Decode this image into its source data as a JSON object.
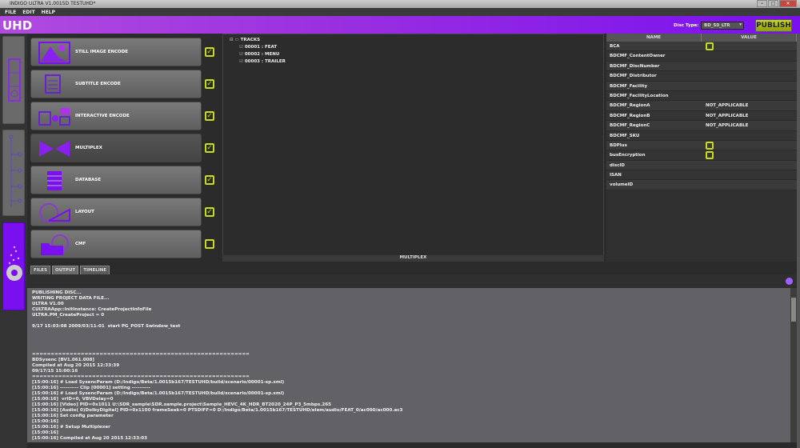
{
  "window": {
    "title": "INDIGO ULTRA V1.0015D TESTUHD*",
    "min": "–",
    "max": "□",
    "close": "✕"
  },
  "menu": [
    "FILE",
    "EDIT",
    "HELP"
  ],
  "header": {
    "title": "UHD",
    "disc_type_label": "Disc Type:",
    "disc_type_value": "BD_50_LTR",
    "publish_label": "PUBLISH",
    "accent": "#9b30e0"
  },
  "steps": [
    {
      "label": "STILL IMAGE ENCODE",
      "checked": true
    },
    {
      "label": "SUBTITLE ENCODE",
      "checked": true
    },
    {
      "label": "INTERACTIVE ENCODE",
      "checked": true
    },
    {
      "label": "MULTIPLEX",
      "checked": true
    },
    {
      "label": "DATABASE",
      "checked": true
    },
    {
      "label": "LAYOUT",
      "checked": true
    },
    {
      "label": "CMF",
      "checked": false
    }
  ],
  "tree": {
    "root": "TRACKS",
    "items": [
      "00001 : FEAT",
      "00002 : MENU",
      "00003 : TRAILER"
    ],
    "footer": "MULTIPLEX"
  },
  "properties": {
    "headers": [
      "NAME",
      "VALUE"
    ],
    "rows": [
      {
        "name": "BCA",
        "value": "",
        "checkbox": true
      },
      {
        "name": "BDCMF_ContentOwner",
        "value": ""
      },
      {
        "name": "BDCMF_DiscNumber",
        "value": ""
      },
      {
        "name": "BDCMF_Distributor",
        "value": ""
      },
      {
        "name": "BDCMF_Facility",
        "value": ""
      },
      {
        "name": "BDCMF_FacilityLocation",
        "value": ""
      },
      {
        "name": "BDCMF_RegionA",
        "value": "NOT_APPLICABLE"
      },
      {
        "name": "BDCMF_RegionB",
        "value": "NOT_APPLICABLE"
      },
      {
        "name": "BDCMF_RegionC",
        "value": "NOT_APPLICABLE"
      },
      {
        "name": "BDCMF_SKU",
        "value": ""
      },
      {
        "name": "BDPlus",
        "value": "",
        "checkbox": true
      },
      {
        "name": "busEncryption",
        "value": "",
        "checkbox": true
      },
      {
        "name": "discID",
        "value": ""
      },
      {
        "name": "ISAN",
        "value": ""
      },
      {
        "name": "volumeID",
        "value": ""
      }
    ]
  },
  "tabs": [
    "FILES",
    "OUTPUT",
    "TIMELINE"
  ],
  "output": [
    "PUBLISHING DISC...",
    "WRITING PROJECT DATA FILE...",
    "ULTRA V1.00",
    "CULTRAApp::InitInstance: CreateProjectInfoFile",
    "ULTRA.PM_CreateProject = 0",
    "",
    "9/17 15:03:08 2009/03/11-01  start PG_POST Swindow_test",
    "",
    "",
    "",
    "",
    "==========================================================",
    "BDSysenc [BV1.061.008]",
    "Compiled at Aug 20 2015 12:33:39",
    "09/17/15 15:00:16",
    "==========================================================",
    "[15:00:16] # Load SysencParam (D:/Indigo/Beta/1.0015b167/TESTUHD/build/scenario/00001-sp.xml)",
    "[15:00:16] ---------- Clip [00001] setting ----------",
    "[15:00:16] # Load SysencParam (D:/Indigo/Beta/1.0015b167/TESTUHD/build/scenario/00001-sp.xml)",
    "[15:00:16]  vrID=0, VBVDelay=0",
    "[15:00:16] [Video] PID=0x1011 U:\\SDR_sample\\SDR.sample.project\\Sample_HEVC_4K_HDR_BT2020_24P_P3_5mbps.265",
    "[15:00:16] [Audio( 0)DolbyDigital] PID=0x1100 frameSeek=0 PTSDIFF=0 D:/Indigo/Beta/1.0015b167/TESTUHD/elem/audio/FEAT_0/ac000/ac000.ac3",
    "[15:00:16] Set config parameter",
    "[15:00:16]",
    "[15:00:16] # Setup Multiplexer",
    "[15:00:16]",
    "[15:00:16] Compiled at Aug 20 2015 12:33:03"
  ]
}
